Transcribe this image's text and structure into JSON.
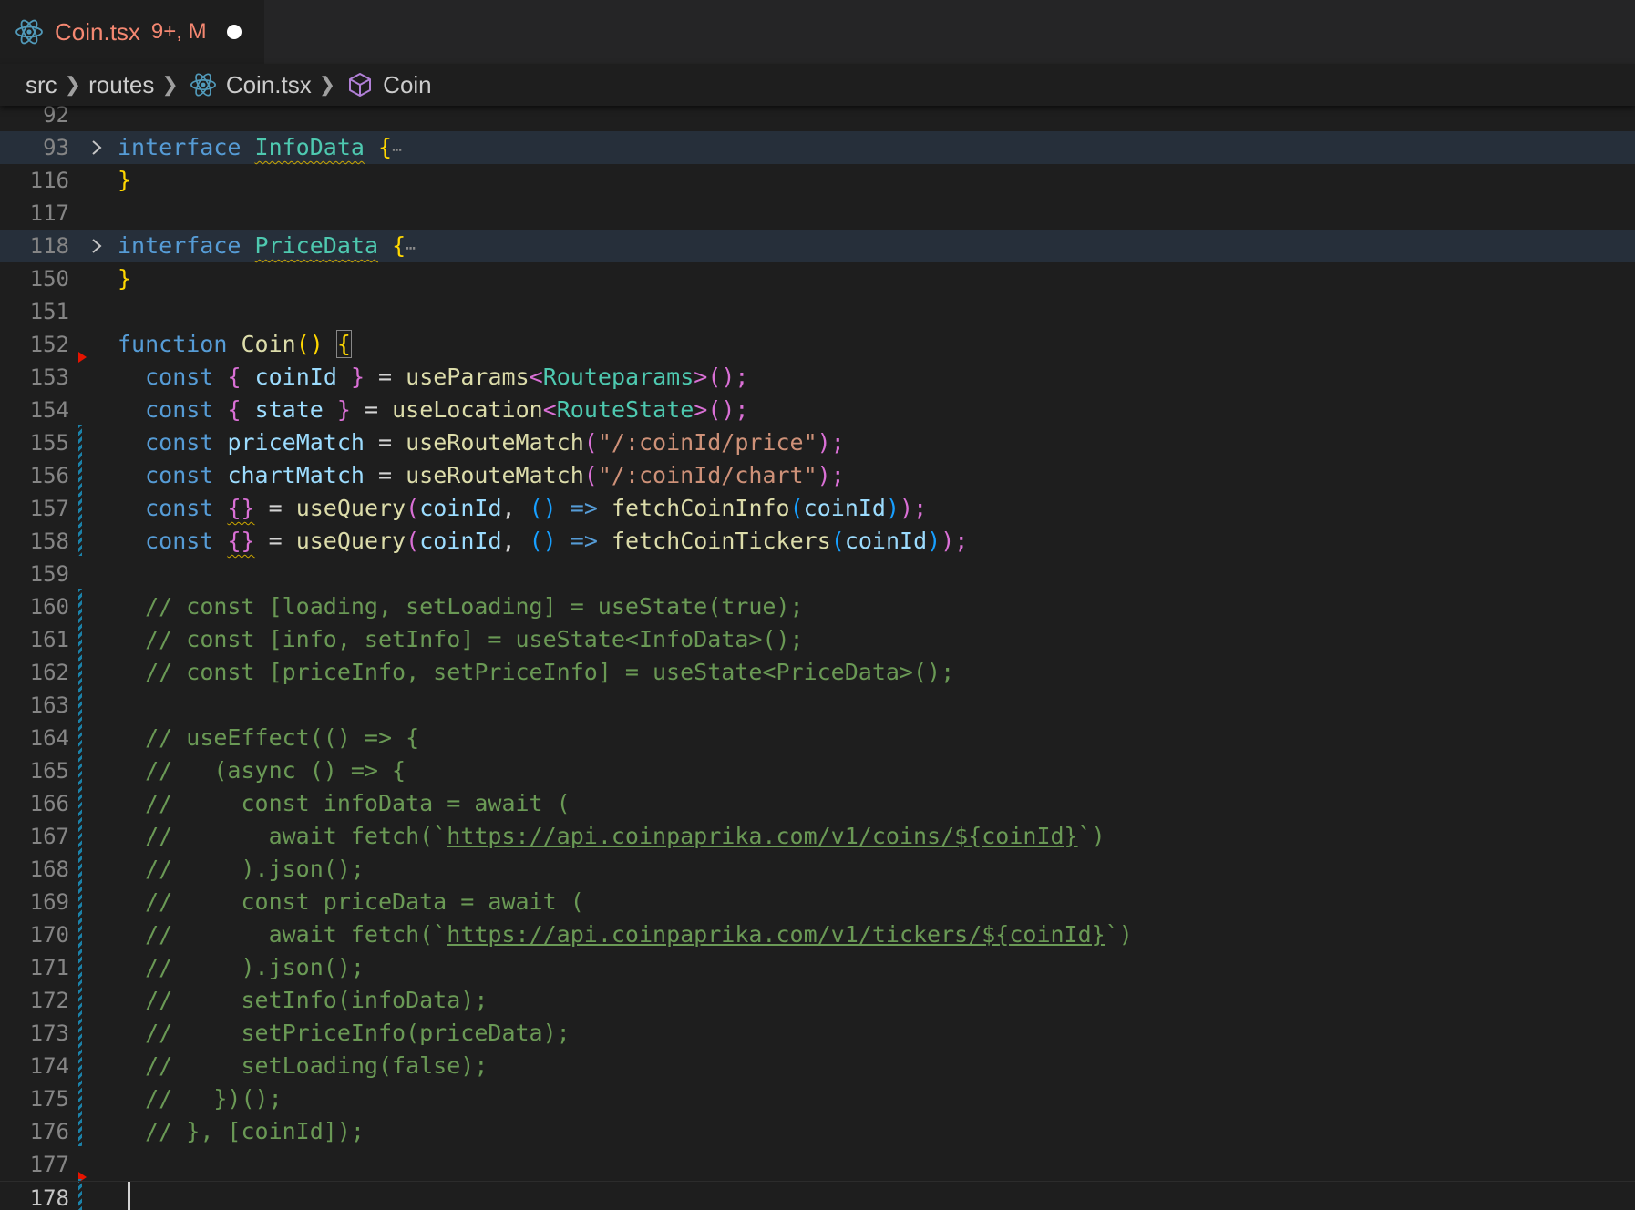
{
  "tab": {
    "file_name": "Coin.tsx",
    "status": "9+, M",
    "icon": "react-icon"
  },
  "breadcrumb": {
    "parts": [
      "src",
      "routes",
      "Coin.tsx",
      "Coin"
    ],
    "icons": [
      "react-icon",
      "symbol-class-icon"
    ]
  },
  "editor": {
    "lines": [
      {
        "n": "92"
      },
      {
        "n": "93"
      },
      {
        "n": "116"
      },
      {
        "n": "117"
      },
      {
        "n": "118"
      },
      {
        "n": "150"
      },
      {
        "n": "151"
      },
      {
        "n": "152"
      },
      {
        "n": "153"
      },
      {
        "n": "154"
      },
      {
        "n": "155"
      },
      {
        "n": "156"
      },
      {
        "n": "157"
      },
      {
        "n": "158"
      },
      {
        "n": "159"
      },
      {
        "n": "160"
      },
      {
        "n": "161"
      },
      {
        "n": "162"
      },
      {
        "n": "163"
      },
      {
        "n": "164"
      },
      {
        "n": "165"
      },
      {
        "n": "166"
      },
      {
        "n": "167"
      },
      {
        "n": "168"
      },
      {
        "n": "169"
      },
      {
        "n": "170"
      },
      {
        "n": "171"
      },
      {
        "n": "172"
      },
      {
        "n": "173"
      },
      {
        "n": "174"
      },
      {
        "n": "175"
      },
      {
        "n": "176"
      },
      {
        "n": "177"
      },
      {
        "n": "178"
      }
    ],
    "tokens": {
      "interface": "interface",
      "InfoData": "InfoData",
      "PriceData": "PriceData",
      "brace_open": "{",
      "brace_close": "}",
      "ellipsis": "⋯",
      "function_kw": "function",
      "Coin": "Coin",
      "paren_pair": "()",
      "const": "const",
      "coinId": "coinId",
      "state": "state",
      "eq": " = ",
      "useParams": "useParams",
      "Routeparams": "Routeparams",
      "useLocation": "useLocation",
      "RouteState": "RouteState",
      "lt": "<",
      "gt": ">",
      "call_end": "();",
      "priceMatch": "priceMatch",
      "chartMatch": "chartMatch",
      "useRouteMatch": "useRouteMatch",
      "paren_open": "(",
      "paren_close": ")",
      "stmt_end": ");",
      "price_path": "\"/:coinId/price\"",
      "chart_path": "\"/:coinId/chart\"",
      "empty_obj": "{}",
      "useQuery": "useQuery",
      "comma": ", ",
      "arrow": " => ",
      "fetchCoinInfo": "fetchCoinInfo",
      "fetchCoinTickers": "fetchCoinTickers"
    },
    "comments": {
      "c160": "// const [loading, setLoading] = useState(true);",
      "c161": "// const [info, setInfo] = useState<InfoData>();",
      "c162": "// const [priceInfo, setPriceInfo] = useState<PriceData>();",
      "c164": "// useEffect(() => {",
      "c165": "//   (async () => {",
      "c166": "//     const infoData = await (",
      "c167_pre": "//       await fetch(`",
      "c167_url": "https://api.coinpaprika.com/v1/coins/${coinId}",
      "c167_post": "`)",
      "c168": "//     ).json();",
      "c169": "//     const priceData = await (",
      "c170_pre": "//       await fetch(`",
      "c170_url": "https://api.coinpaprika.com/v1/tickers/${coinId}",
      "c170_post": "`)",
      "c171": "//     ).json();",
      "c172": "//     setInfo(infoData);",
      "c173": "//     setPriceInfo(priceData);",
      "c174": "//     setLoading(false);",
      "c175": "//   })();",
      "c176": "// }, [coinId]);"
    }
  }
}
